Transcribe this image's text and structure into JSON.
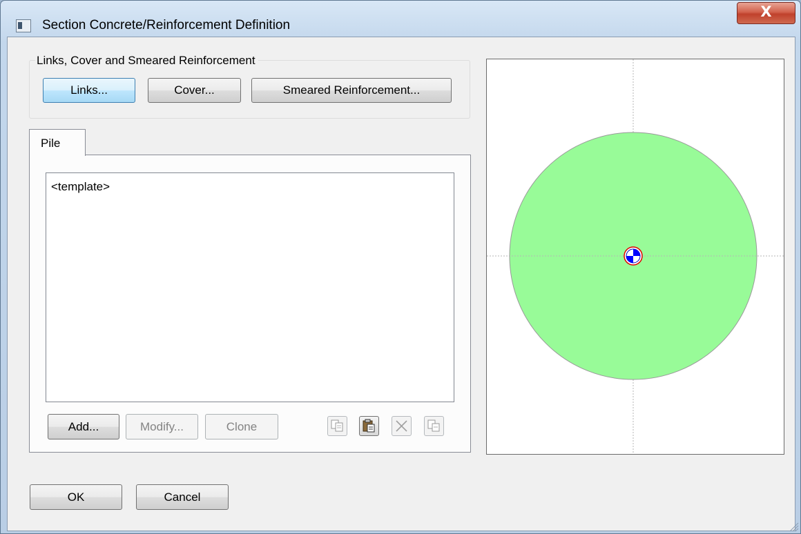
{
  "window": {
    "title": "Section Concrete/Reinforcement Definition",
    "close_label": "X"
  },
  "group": {
    "legend": "Links, Cover and Smeared Reinforcement",
    "links_label": "Links...",
    "cover_label": "Cover...",
    "smeared_label": "Smeared Reinforcement..."
  },
  "tabs": [
    {
      "label": "Pile"
    }
  ],
  "list": {
    "items": [
      "<template>"
    ]
  },
  "list_actions": {
    "add_label": "Add...",
    "modify_label": "Modify...",
    "clone_label": "Clone"
  },
  "icon_buttons": [
    {
      "name": "copy-icon",
      "enabled": false
    },
    {
      "name": "paste-icon",
      "enabled": true
    },
    {
      "name": "delete-icon",
      "enabled": false
    },
    {
      "name": "duplicate-icon",
      "enabled": false
    }
  ],
  "footer": {
    "ok_label": "OK",
    "cancel_label": "Cancel"
  },
  "preview": {
    "section_shape": "circle",
    "section_fill": "#98fb98",
    "section_outline": "#999999",
    "axis_color": "#b4b4b4",
    "centroid_marker": "blue-white-quadrant-circle",
    "centroid_ring_color": "#e00000",
    "centroid_fill_color": "#0000ff"
  },
  "colors": {
    "title_gradient_top": "#d8e7f6",
    "close_button": "#c0412c",
    "focused_button": "#bee6fd",
    "dialog_background": "#f0f0f0"
  }
}
